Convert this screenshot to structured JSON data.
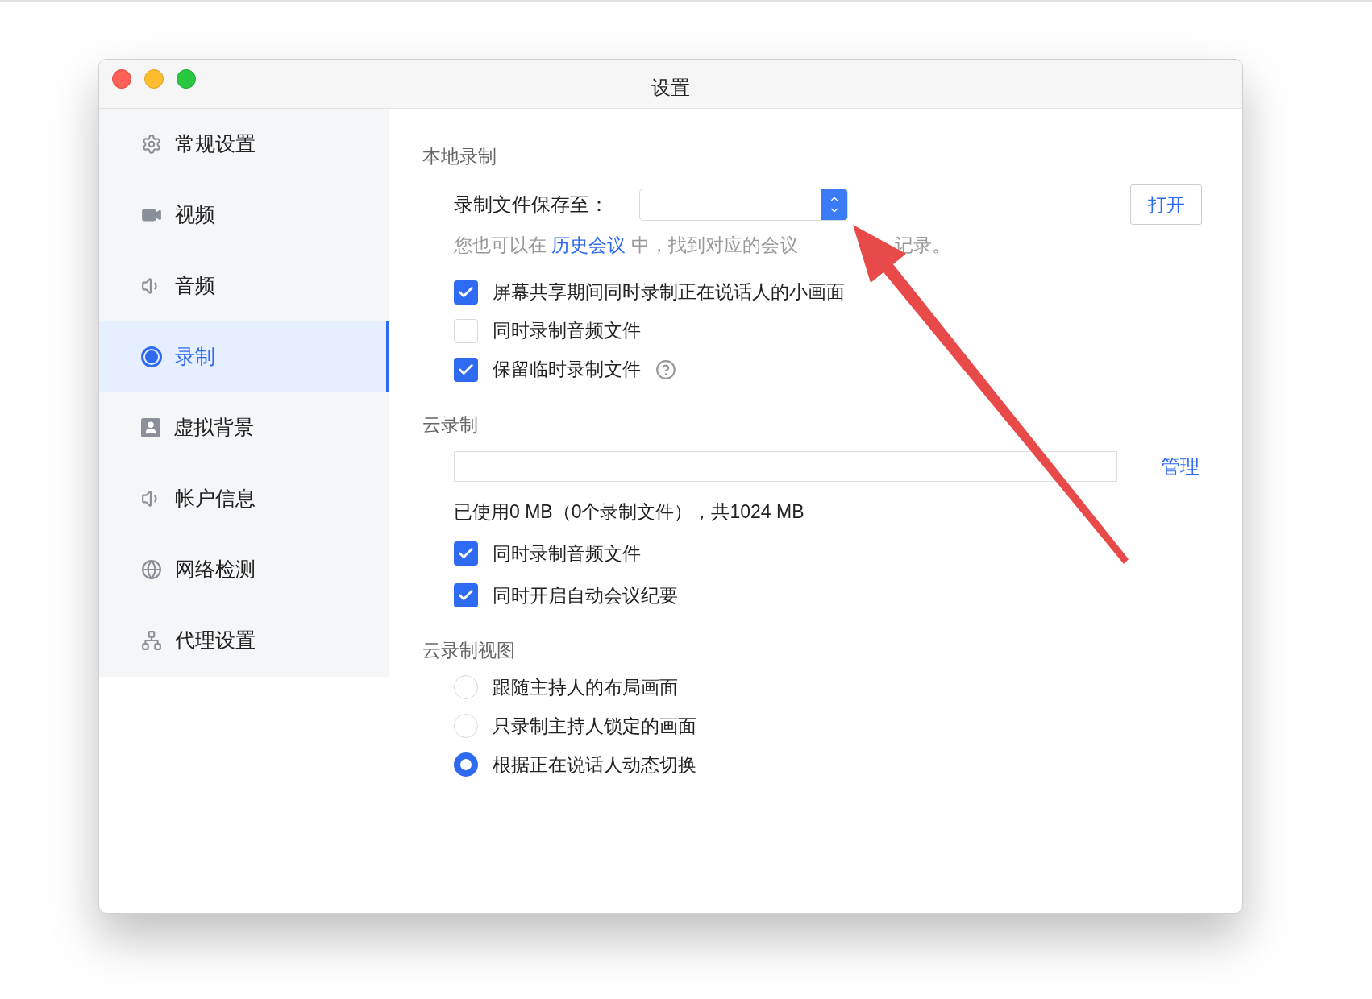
{
  "window": {
    "title": "设置"
  },
  "sidebar": {
    "items": [
      {
        "label": "常规设置",
        "selected": false,
        "kind": "gear"
      },
      {
        "label": "视频",
        "selected": false,
        "kind": "video"
      },
      {
        "label": "音频",
        "selected": false,
        "kind": "speaker"
      },
      {
        "label": "录制",
        "selected": true,
        "kind": "record"
      },
      {
        "label": "虚拟背景",
        "selected": false,
        "kind": "portrait"
      },
      {
        "label": "帐户信息",
        "selected": false,
        "kind": "speaker"
      },
      {
        "label": "网络检测",
        "selected": false,
        "kind": "globe"
      },
      {
        "label": "代理设置",
        "selected": false,
        "kind": "network"
      }
    ]
  },
  "local_recording": {
    "title": "本地录制",
    "save_path_label": "录制文件保存至：",
    "open_button": "打开",
    "hint_before": "您也可以在",
    "hint_link": "历史会议",
    "hint_after": "中，找到对应的会议",
    "hint_tail": "记录。",
    "options": [
      {
        "label": "屏幕共享期间同时录制正在说话人的小画面",
        "checked": true,
        "help": false
      },
      {
        "label": "同时录制音频文件",
        "checked": false,
        "help": false
      },
      {
        "label": "保留临时录制文件",
        "checked": true,
        "help": true
      }
    ]
  },
  "cloud_recording": {
    "title": "云录制",
    "manage_link": "管理",
    "usage": "已使用0 MB（0个录制文件），共1024 MB",
    "options": [
      {
        "label": "同时录制音频文件",
        "checked": true
      },
      {
        "label": "同时开启自动会议纪要",
        "checked": true
      }
    ]
  },
  "cloud_view": {
    "title": "云录制视图",
    "options": [
      {
        "label": "跟随主持人的布局画面",
        "selected": false
      },
      {
        "label": "只录制主持人锁定的画面",
        "selected": false
      },
      {
        "label": "根据正在说话人动态切换",
        "selected": true
      }
    ]
  }
}
